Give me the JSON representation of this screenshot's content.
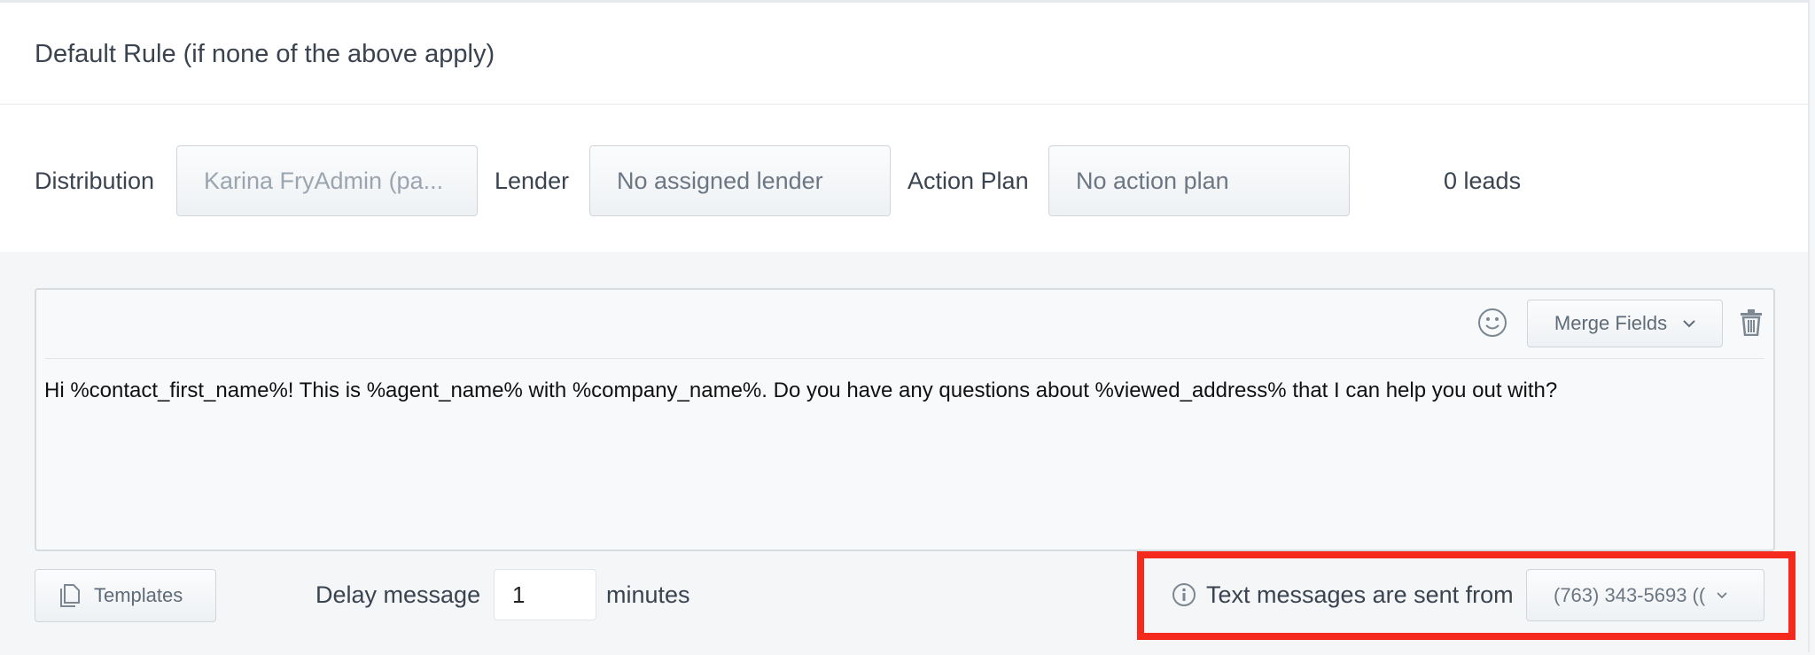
{
  "header": {
    "title": "Default Rule (if none of the above apply)"
  },
  "rule": {
    "distribution_label": "Distribution",
    "distribution_value": "Karina FryAdmin (pa...",
    "lender_label": "Lender",
    "lender_value": "No assigned lender",
    "action_plan_label": "Action Plan",
    "action_plan_value": "No action plan",
    "leads_count": "0 leads"
  },
  "editor": {
    "merge_fields_label": "Merge Fields",
    "message": "Hi %contact_first_name%! This is %agent_name% with %company_name%. Do you have any questions about %viewed_address% that I can help you out with?"
  },
  "footer": {
    "templates_label": "Templates",
    "delay_label": "Delay message",
    "delay_value": "1",
    "minutes_label": "minutes",
    "sent_from_label": "Text messages are sent from",
    "sent_from_value": "(763) 343-5693 (("
  },
  "colors": {
    "highlight": "#f52a1c",
    "text": "#3a4350",
    "muted": "#9aa5b0"
  }
}
